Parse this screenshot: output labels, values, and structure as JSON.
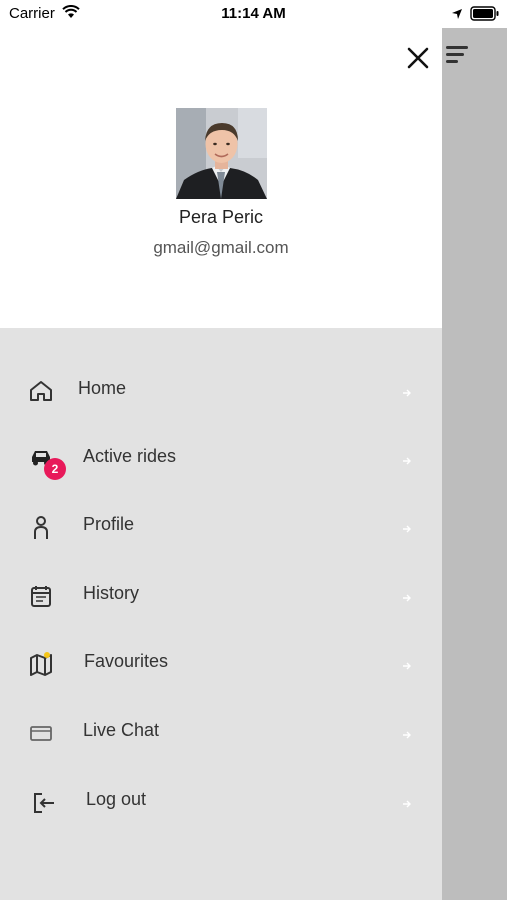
{
  "status_bar": {
    "carrier": "Carrier",
    "time": "11:14 AM"
  },
  "profile": {
    "name": "Pera Peric",
    "email": "gmail@gmail.com"
  },
  "menu": {
    "items": [
      {
        "label": "Home",
        "icon": "home-icon"
      },
      {
        "label": "Active rides",
        "icon": "car-icon",
        "badge": "2"
      },
      {
        "label": "Profile",
        "icon": "person-icon"
      },
      {
        "label": "History",
        "icon": "calendar-icon"
      },
      {
        "label": "Favourites",
        "icon": "map-icon"
      },
      {
        "label": "Live Chat",
        "icon": "mail-icon"
      },
      {
        "label": "Log out",
        "icon": "logout-icon"
      }
    ]
  },
  "colors": {
    "badge": "#e8195a",
    "drawer_bg": "#e2e2e2",
    "header_bg": "#ffffff",
    "overlay": "#bdbdbd",
    "favourite_dot": "#f5c518"
  }
}
